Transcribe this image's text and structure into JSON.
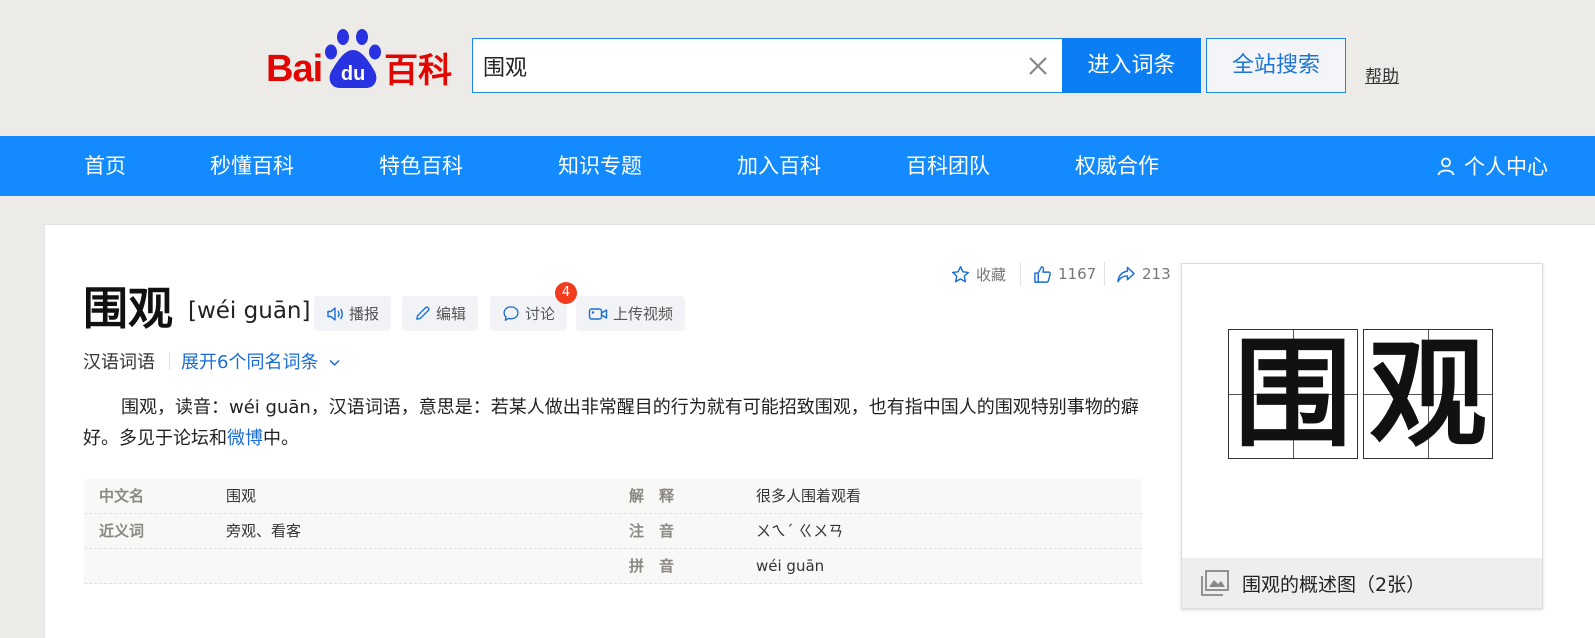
{
  "header": {
    "logo_bai": "Bai",
    "logo_du": "du",
    "logo_baike": "百科",
    "search_value": "围观",
    "enter_label": "进入词条",
    "site_search_label": "全站搜索",
    "help_label": "帮助"
  },
  "nav": {
    "items": [
      "首页",
      "秒懂百科",
      "特色百科",
      "知识专题",
      "加入百科",
      "百科团队",
      "权威合作"
    ],
    "user_center": "个人中心"
  },
  "entry": {
    "title": "围观",
    "pinyin": "[wéi guān]",
    "actions": {
      "play": "播报",
      "edit": "编辑",
      "discuss": "讨论",
      "discuss_count": "4",
      "upload_video": "上传视频"
    },
    "stats": {
      "collect": "收藏",
      "likes": "1167",
      "shares": "213"
    },
    "category": "汉语词语",
    "expand_label": "展开6个同名词条",
    "summary_before_link": "围观，读音：wéi guān，汉语词语，意思是：若某人做出非常醒目的行为就有可能招致围观，也有指中国人的围观特别事物的癖好。多见于论坛和",
    "summary_link": "微博",
    "summary_after_link": "中。"
  },
  "basic_info": {
    "rows": [
      {
        "k1": "中文名",
        "v1": "围观",
        "k2": "解　释",
        "v2": "很多人围着观看"
      },
      {
        "k1": "近义词",
        "v1": "旁观、看客",
        "k2": "注　音",
        "v2": "ㄨㄟˊ ㄍㄨㄢ"
      },
      {
        "k1": "",
        "v1": "",
        "k2": "拼　音",
        "v2": "wéi guān"
      }
    ]
  },
  "summary_pic": {
    "chars": [
      "围",
      "观"
    ],
    "caption": "围观的概述图（2张）"
  },
  "colors": {
    "nav_blue": "#138bff",
    "button_blue": "#0a7ef2",
    "logo_red": "#e10602",
    "logo_blue": "#2932e1",
    "badge_red": "#f23c1e",
    "link_blue": "#1a6ed6"
  }
}
